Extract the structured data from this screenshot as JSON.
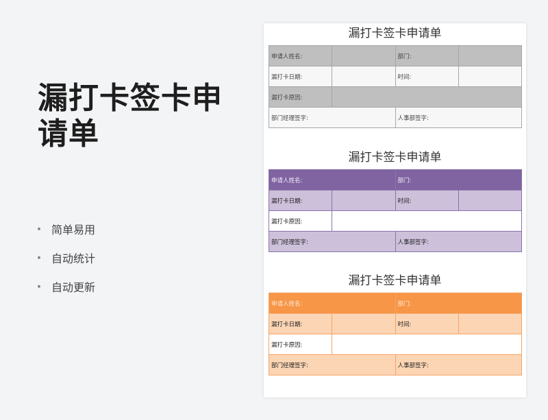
{
  "hero": {
    "title": "漏打卡签卡申请单",
    "features": [
      "简单易用",
      "自动统计",
      "自动更新"
    ]
  },
  "form": {
    "title": "漏打卡签卡申请单",
    "applicant_label": "申请人姓名:",
    "department_label": "部门:",
    "date_label": "漏打卡日期:",
    "time_label": "时间:",
    "reason_label": "漏打卡原因:",
    "manager_sign_label": "部门经理签字:",
    "hr_sign_label": "人事部签字:"
  },
  "styles": [
    {
      "name": "grey",
      "header_color": "#bfbfbf",
      "row_color": "#f7f7f7"
    },
    {
      "name": "purple",
      "header_color": "#8064a2",
      "row_color": "#ccc0da"
    },
    {
      "name": "orange",
      "header_color": "#f79646",
      "row_color": "#fcd5b4"
    }
  ]
}
